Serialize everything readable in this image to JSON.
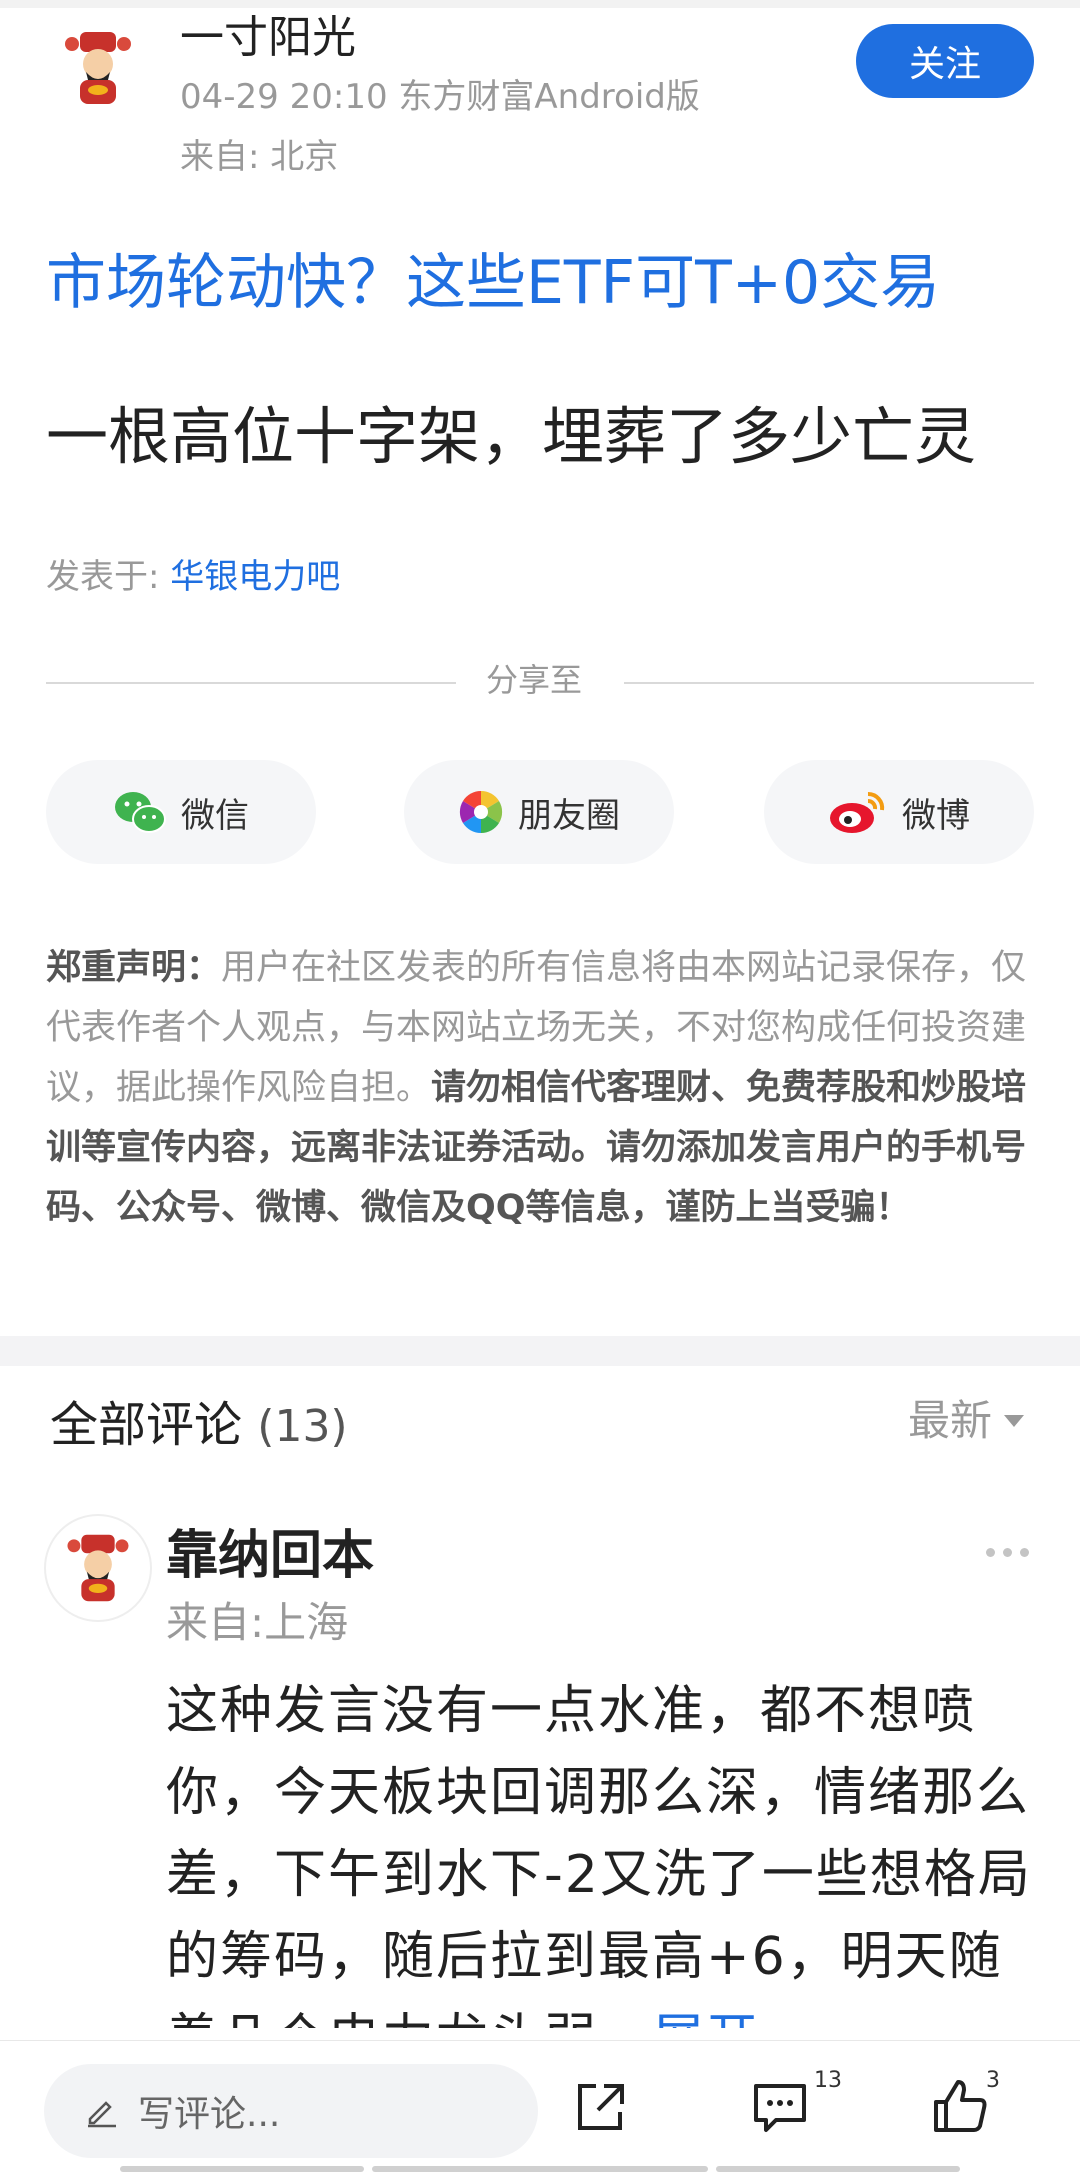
{
  "header": {
    "author": "一寸阳光",
    "meta_line": "04-29 20:10 东方财富Android版",
    "location": "来自: 北京",
    "follow_label": "关注"
  },
  "ad_title": "市场轮动快？这些ETF可T+0交易",
  "post_title": "一根高位十字架，埋葬了多少亡灵",
  "posted_in": {
    "prefix": "发表于: ",
    "bar_name": "华银电力吧"
  },
  "share": {
    "label": "分享至",
    "buttons": [
      {
        "label": "微信",
        "icon": "wechat-icon"
      },
      {
        "label": "朋友圈",
        "icon": "moments-icon"
      },
      {
        "label": "微博",
        "icon": "weibo-icon"
      }
    ]
  },
  "disclaimer": {
    "title": "郑重声明：",
    "normal": "用户在社区发表的所有信息将由本网站记录保存，仅代表作者个人观点，与本网站立场无关，不对您构成任何投资建议，据此操作风险自担。",
    "bold": "请勿相信代客理财、免费荐股和炒股培训等宣传内容，远离非法证券活动。请勿添加发言用户的手机号码、公众号、微博、微信及QQ等信息，谨防上当受骗！"
  },
  "comments": {
    "title": "全部评论",
    "count": "(13)",
    "sort_label": "最新",
    "items": [
      {
        "name": "靠纳回本",
        "from": "来自:上海",
        "text": "这种发言没有一点水准，都不想喷你，今天板块回调那么深，情绪那么差，下午到水下-2又洗了一些想格局的筹码，随后拉到最高+6，明天随着几个电力龙头弱…",
        "expand_label": "展开"
      }
    ]
  },
  "bottom_bar": {
    "write_placeholder": "写评论...",
    "comment_count": "13",
    "like_count": "3"
  }
}
